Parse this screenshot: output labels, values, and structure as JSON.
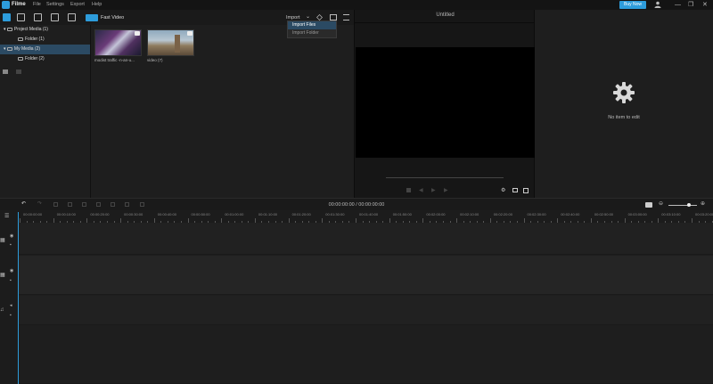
{
  "titlebar": {
    "app_name": "Filme",
    "menu": [
      "File",
      "Settings",
      "Export",
      "Help"
    ],
    "buy_now": "Buy Now",
    "minimize": "—",
    "restore": "❐",
    "close": "✕"
  },
  "toolbar": {
    "fast_video": "Fast Video",
    "import": "Import",
    "import_arrow": "⌄"
  },
  "import_menu": {
    "items": [
      "Import Files",
      "Import Folder"
    ]
  },
  "tree": {
    "items": [
      {
        "label": "Project Media (1)"
      },
      {
        "label": "Folder (1)"
      },
      {
        "label": "My Media (2)"
      },
      {
        "label": "Folder (2)"
      }
    ]
  },
  "media": {
    "items": [
      {
        "caption": "modist traffic -n-an-u..."
      },
      {
        "caption": "video (7)"
      }
    ]
  },
  "preview": {
    "title": "Untitled"
  },
  "right_panel": {
    "empty_text": "No item to edit"
  },
  "timeline": {
    "timecode": "00:00:00:00 / 00:00:00:00",
    "ticks": [
      "00:00:00:00",
      "00:00:10:00",
      "00:00:20:00",
      "00:00:30:00",
      "00:00:40:00",
      "00:00:50:00",
      "00:01:00:00",
      "00:01:10:00",
      "00:01:20:00",
      "00:01:30:00",
      "00:01:40:00",
      "00:01:50:00",
      "00:02:00:00",
      "00:02:10:00",
      "00:02:20:00",
      "00:02:30:00",
      "00:02:40:00",
      "00:02:50:00",
      "00:03:00:00",
      "00:03:10:00",
      "00:03:20:00"
    ]
  },
  "colors": {
    "accent": "#2d9cdb",
    "selection": "#2b4a63"
  }
}
